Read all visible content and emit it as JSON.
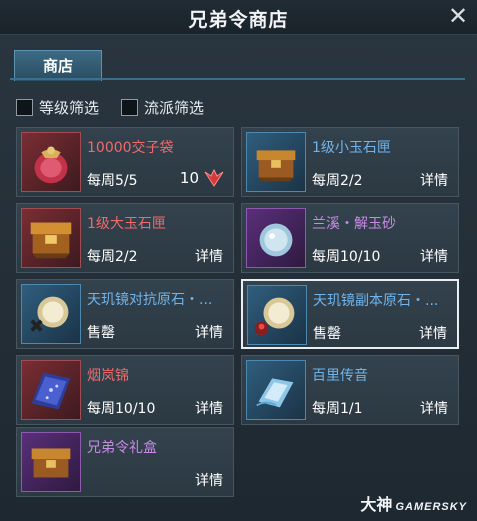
{
  "window": {
    "title": "兄弟令商店",
    "close_glyph": "✕"
  },
  "tabs": [
    {
      "label": "商店",
      "active": true
    }
  ],
  "filters": [
    {
      "label": "等级筛选",
      "checked": false
    },
    {
      "label": "流派筛选",
      "checked": false
    }
  ],
  "colors": {
    "name_red": "#f06a6a",
    "name_blue": "#6fb4ea",
    "name_purple": "#c98ae6",
    "accent": "#5d93b2"
  },
  "items": [
    {
      "name": "10000交子袋",
      "name_color": "red",
      "limit": "每周5/5",
      "count": "10",
      "action": "",
      "icon": "pouch-icon",
      "rarity": "red",
      "selected": false
    },
    {
      "name": "1级小玉石匣",
      "name_color": "blue",
      "limit": "每周2/2",
      "count": "",
      "action": "详情",
      "icon": "small-jade-box-icon",
      "rarity": "blue",
      "selected": false
    },
    {
      "name": "1级大玉石匣",
      "name_color": "red",
      "limit": "每周2/2",
      "count": "",
      "action": "详情",
      "icon": "large-jade-box-icon",
      "rarity": "red",
      "selected": false
    },
    {
      "name": "兰溪・解玉砂",
      "name_color": "purple",
      "limit": "每周10/10",
      "count": "",
      "action": "详情",
      "icon": "jade-sand-icon",
      "rarity": "purple",
      "selected": false
    },
    {
      "name": "天玑镜对抗原石・...",
      "name_color": "blue",
      "limit": "售罄",
      "count": "",
      "action": "详情",
      "icon": "mirror-pvp-icon",
      "rarity": "blue",
      "selected": false
    },
    {
      "name": "天玑镜副本原石・...",
      "name_color": "blue",
      "limit": "售罄",
      "count": "",
      "action": "详情",
      "icon": "mirror-dungeon-icon",
      "rarity": "blue",
      "selected": true
    },
    {
      "name": "烟岚锦",
      "name_color": "red",
      "limit": "每周10/10",
      "count": "",
      "action": "详情",
      "icon": "brocade-icon",
      "rarity": "red",
      "selected": false
    },
    {
      "name": "百里传音",
      "name_color": "blue",
      "limit": "每周1/1",
      "count": "",
      "action": "详情",
      "icon": "message-icon",
      "rarity": "blue",
      "selected": false
    },
    {
      "name": "兄弟令礼盒",
      "name_color": "purple",
      "limit": "",
      "count": "",
      "action": "详情",
      "icon": "gift-box-icon",
      "rarity": "purple",
      "selected": false
    }
  ],
  "watermark": {
    "cn": "大神",
    "en": "GAMERSKY"
  }
}
